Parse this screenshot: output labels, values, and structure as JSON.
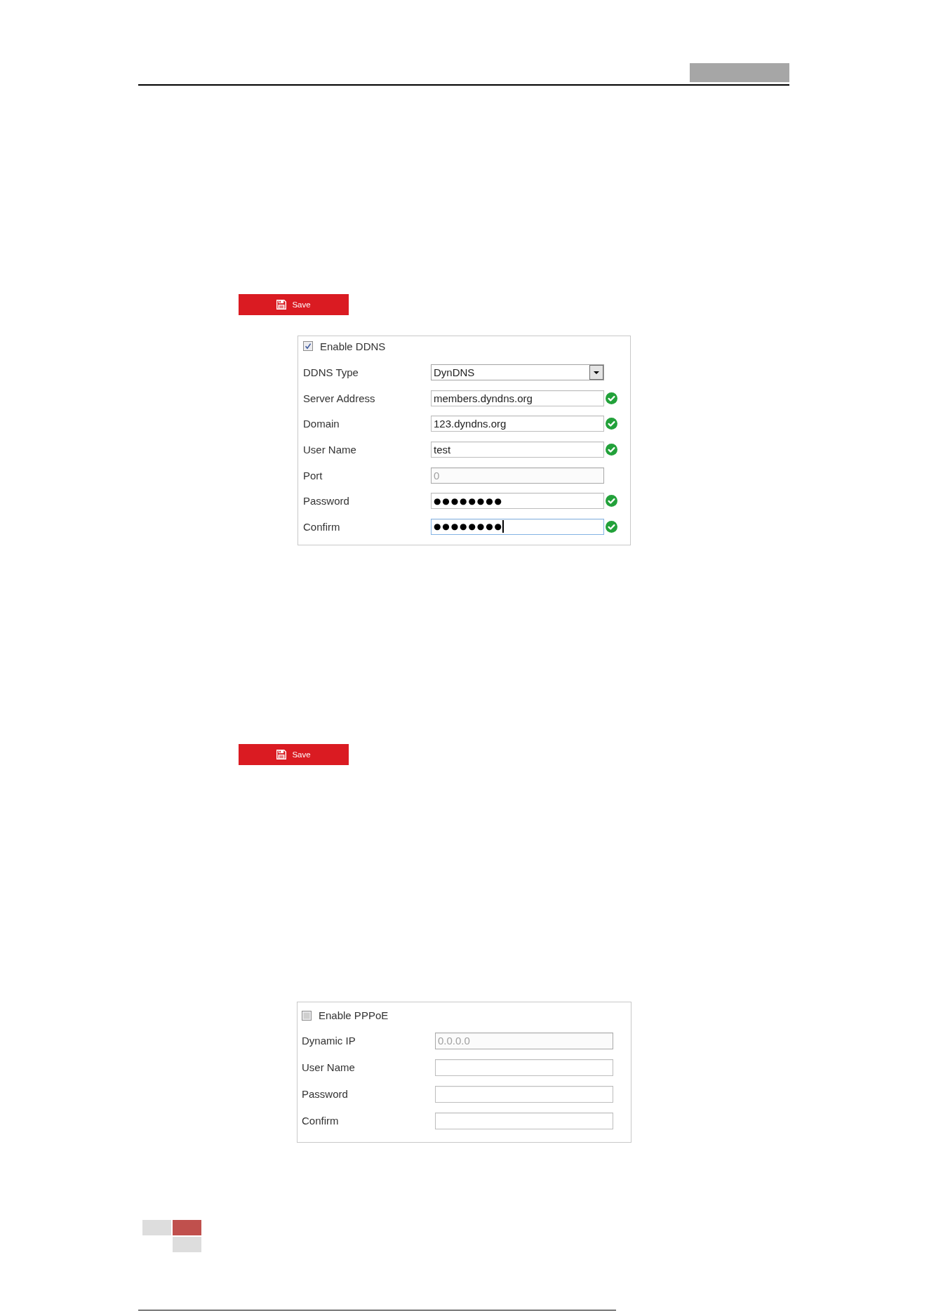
{
  "blocks": [
    {
      "kind": "save_button",
      "label": "Save"
    },
    {
      "kind": "panel",
      "enable": {
        "label": "Enable DDNS",
        "checked": true
      },
      "fields": [
        {
          "kind": "select",
          "label": "DDNS Type",
          "value": "DynDNS",
          "disabled": false,
          "focused": false,
          "valid": false
        },
        {
          "kind": "text",
          "label": "Server Address",
          "value": "members.dyndns.org",
          "disabled": false,
          "focused": false,
          "valid": true
        },
        {
          "kind": "text",
          "label": "Domain",
          "value": "123.dyndns.org",
          "disabled": false,
          "focused": false,
          "valid": true
        },
        {
          "kind": "text",
          "label": "User Name",
          "value": "test",
          "disabled": false,
          "focused": false,
          "valid": true
        },
        {
          "kind": "text",
          "label": "Port",
          "value": "0",
          "disabled": true,
          "focused": false,
          "valid": false
        },
        {
          "kind": "password",
          "label": "Password",
          "value": "●●●●●●●●",
          "disabled": false,
          "focused": false,
          "valid": true
        },
        {
          "kind": "password",
          "label": "Confirm",
          "value": "●●●●●●●●",
          "disabled": false,
          "focused": true,
          "valid": true
        }
      ]
    },
    {
      "kind": "save_button",
      "label": "Save"
    },
    {
      "kind": "panel",
      "enable": {
        "label": "Enable PPPoE",
        "checked": false
      },
      "fields": [
        {
          "kind": "text",
          "label": "Dynamic IP",
          "value": "0.0.0.0",
          "disabled": true,
          "focused": false,
          "valid": false
        },
        {
          "kind": "text",
          "label": "User Name",
          "disabled": false,
          "focused": false,
          "valid": false
        },
        {
          "kind": "password",
          "label": "Password",
          "disabled": false,
          "focused": false,
          "valid": false
        },
        {
          "kind": "password",
          "label": "Confirm",
          "disabled": false,
          "focused": false,
          "valid": false
        }
      ]
    }
  ]
}
